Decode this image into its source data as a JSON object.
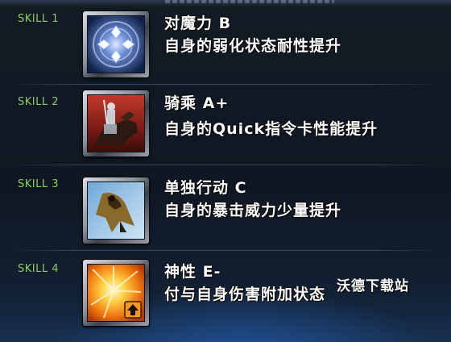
{
  "skills": [
    {
      "label": "SKILL 1",
      "name": "对魔力 B",
      "description": "自身的弱化状态耐性提升",
      "icon": "magic-resistance-rune-icon"
    },
    {
      "label": "SKILL 2",
      "name": "骑乘 A+",
      "description": "自身的Quick指令卡性能提升",
      "icon": "riding-knight-icon"
    },
    {
      "label": "SKILL 3",
      "name": "单独行动 C",
      "description": "自身的暴击威力少量提升",
      "icon": "cloaked-runner-icon"
    },
    {
      "label": "SKILL 4",
      "name": "神性 E-",
      "description": "付与自身伤害附加状态",
      "icon": "divinity-burst-up-arrow-icon"
    }
  ],
  "watermark": "沃德下载站",
  "colors": {
    "skill_label": "#8fd46a",
    "text": "#ffffff",
    "background": "#0f1722"
  }
}
